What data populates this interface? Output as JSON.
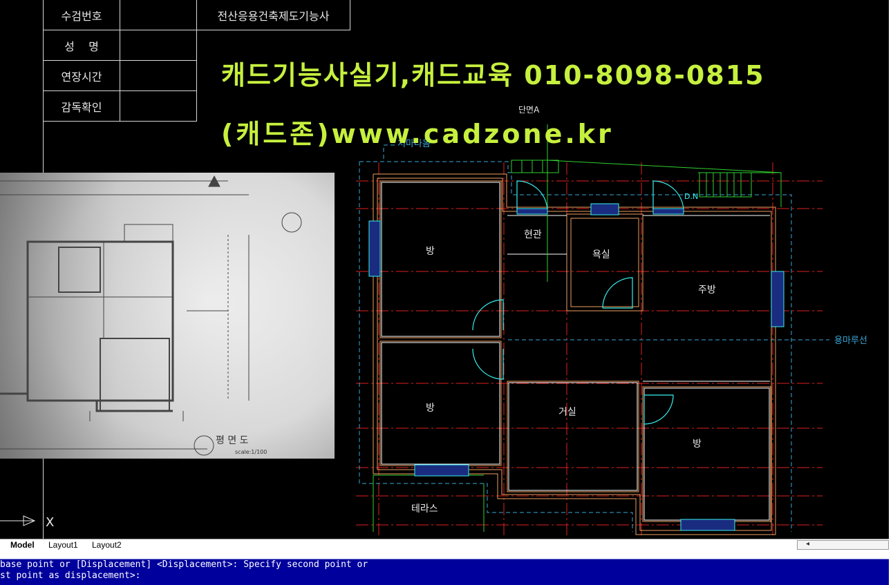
{
  "title_block": {
    "row1_label": "수검번호",
    "row1_value": "전산응용건축제도기능사",
    "row2_label": "성    명",
    "row3_label": "연장시간",
    "row4_label": "감독확인"
  },
  "banner": {
    "line1": "캐드기능사실기,캐드교육 010-8098-0815",
    "line2": "(캐드존)www.cadzone.kr"
  },
  "plan_labels": {
    "section": "단면A",
    "eave": "처마나옴",
    "entrance": "현관",
    "bath": "욕실",
    "kitchen": "주방",
    "room1": "방",
    "room2": "방",
    "room3": "방",
    "living": "거실",
    "terrace": "테라스",
    "floorline": "용마루선",
    "dn": "D.N"
  },
  "photo_labels": {
    "title": "평 면 도",
    "scale": "scale:1/100"
  },
  "ucs": {
    "x_label": "X"
  },
  "tabs": [
    {
      "label": "Model",
      "active": true
    },
    {
      "label": "Layout1",
      "active": false
    },
    {
      "label": "Layout2",
      "active": false
    }
  ],
  "command_line": {
    "line1": "base point or [Displacement] <Displacement>: Specify second point or",
    "line2": "st point as displacement>:"
  },
  "colors": {
    "banner": "#c6f03e",
    "wall": "#f0a060",
    "cyan": "#38f0f0",
    "green": "#30d030",
    "axis": "#e02020",
    "command_bg": "#00009c"
  }
}
